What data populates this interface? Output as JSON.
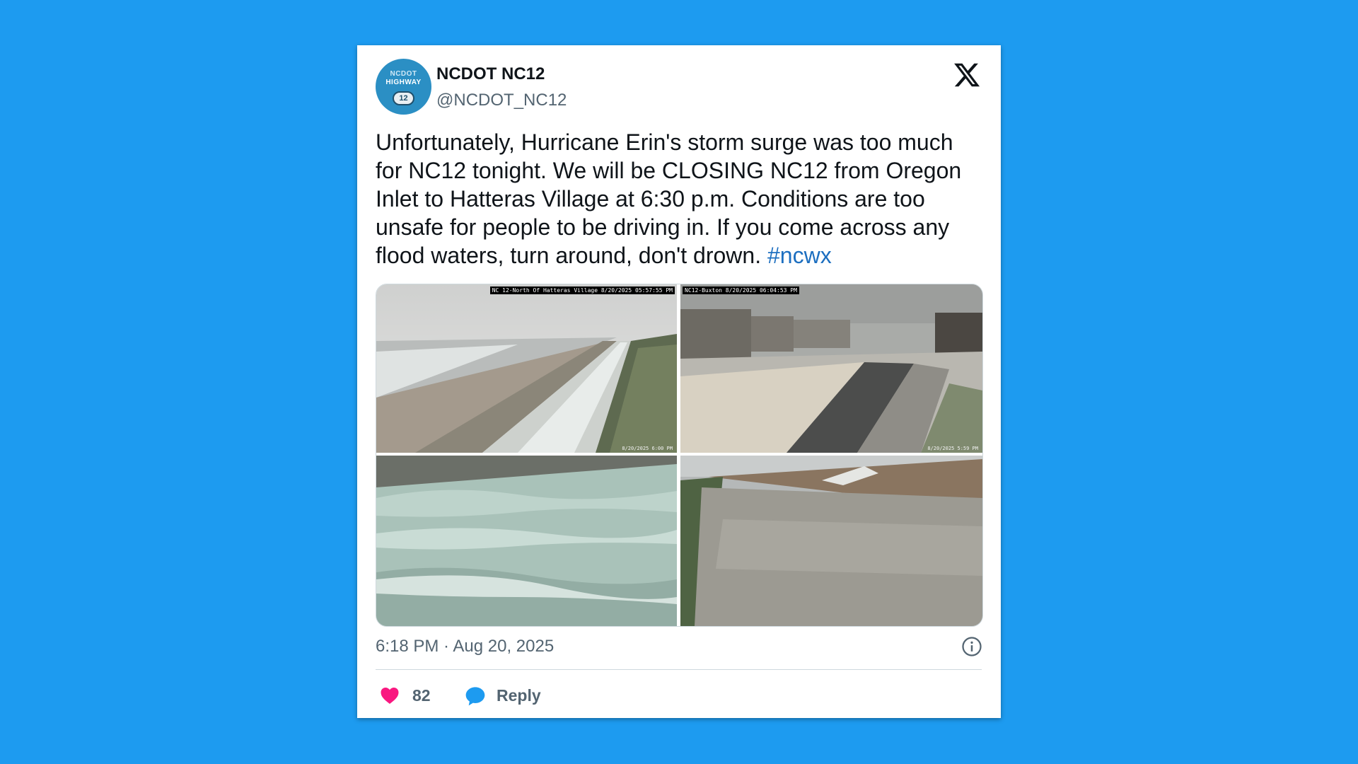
{
  "account": {
    "display_name": "NCDOT NC12",
    "handle": "@NCDOT_NC12",
    "avatar_text_line1": "NCDOT",
    "avatar_text_line2": "HIGHWAY",
    "avatar_shield_number": "12"
  },
  "tweet": {
    "text": "Unfortunately, Hurricane Erin's storm surge was too much for NC12 tonight. We will be CLOSING NC12 from Oregon Inlet to Hatteras Village at 6:30 p.m. Conditions are too unsafe for people to be driving in. If you come across any flood waters, turn around, don't drown. ",
    "hashtag": "#ncwx",
    "timestamp": "6:18 PM · Aug 20, 2025"
  },
  "media": [
    {
      "label": "NC 12-North Of Hatteras Village 8/20/2025 05:57:55 PM",
      "time": "8/20/2025 6:00 PM"
    },
    {
      "label": "NC12-Buxton 8/20/2025 06:04:53 PM",
      "time": "8/20/2025 5:59 PM"
    },
    {
      "label": "",
      "time": ""
    },
    {
      "label": "",
      "time": ""
    }
  ],
  "actions": {
    "like_count": "82",
    "reply_label": "Reply"
  },
  "colors": {
    "background": "#1d9bf0",
    "hashtag": "#1d6fc0",
    "like": "#f91880",
    "reply": "#1d9bf0"
  },
  "icons": [
    "x-logo-icon",
    "info-icon",
    "heart-icon",
    "speech-bubble-icon"
  ]
}
